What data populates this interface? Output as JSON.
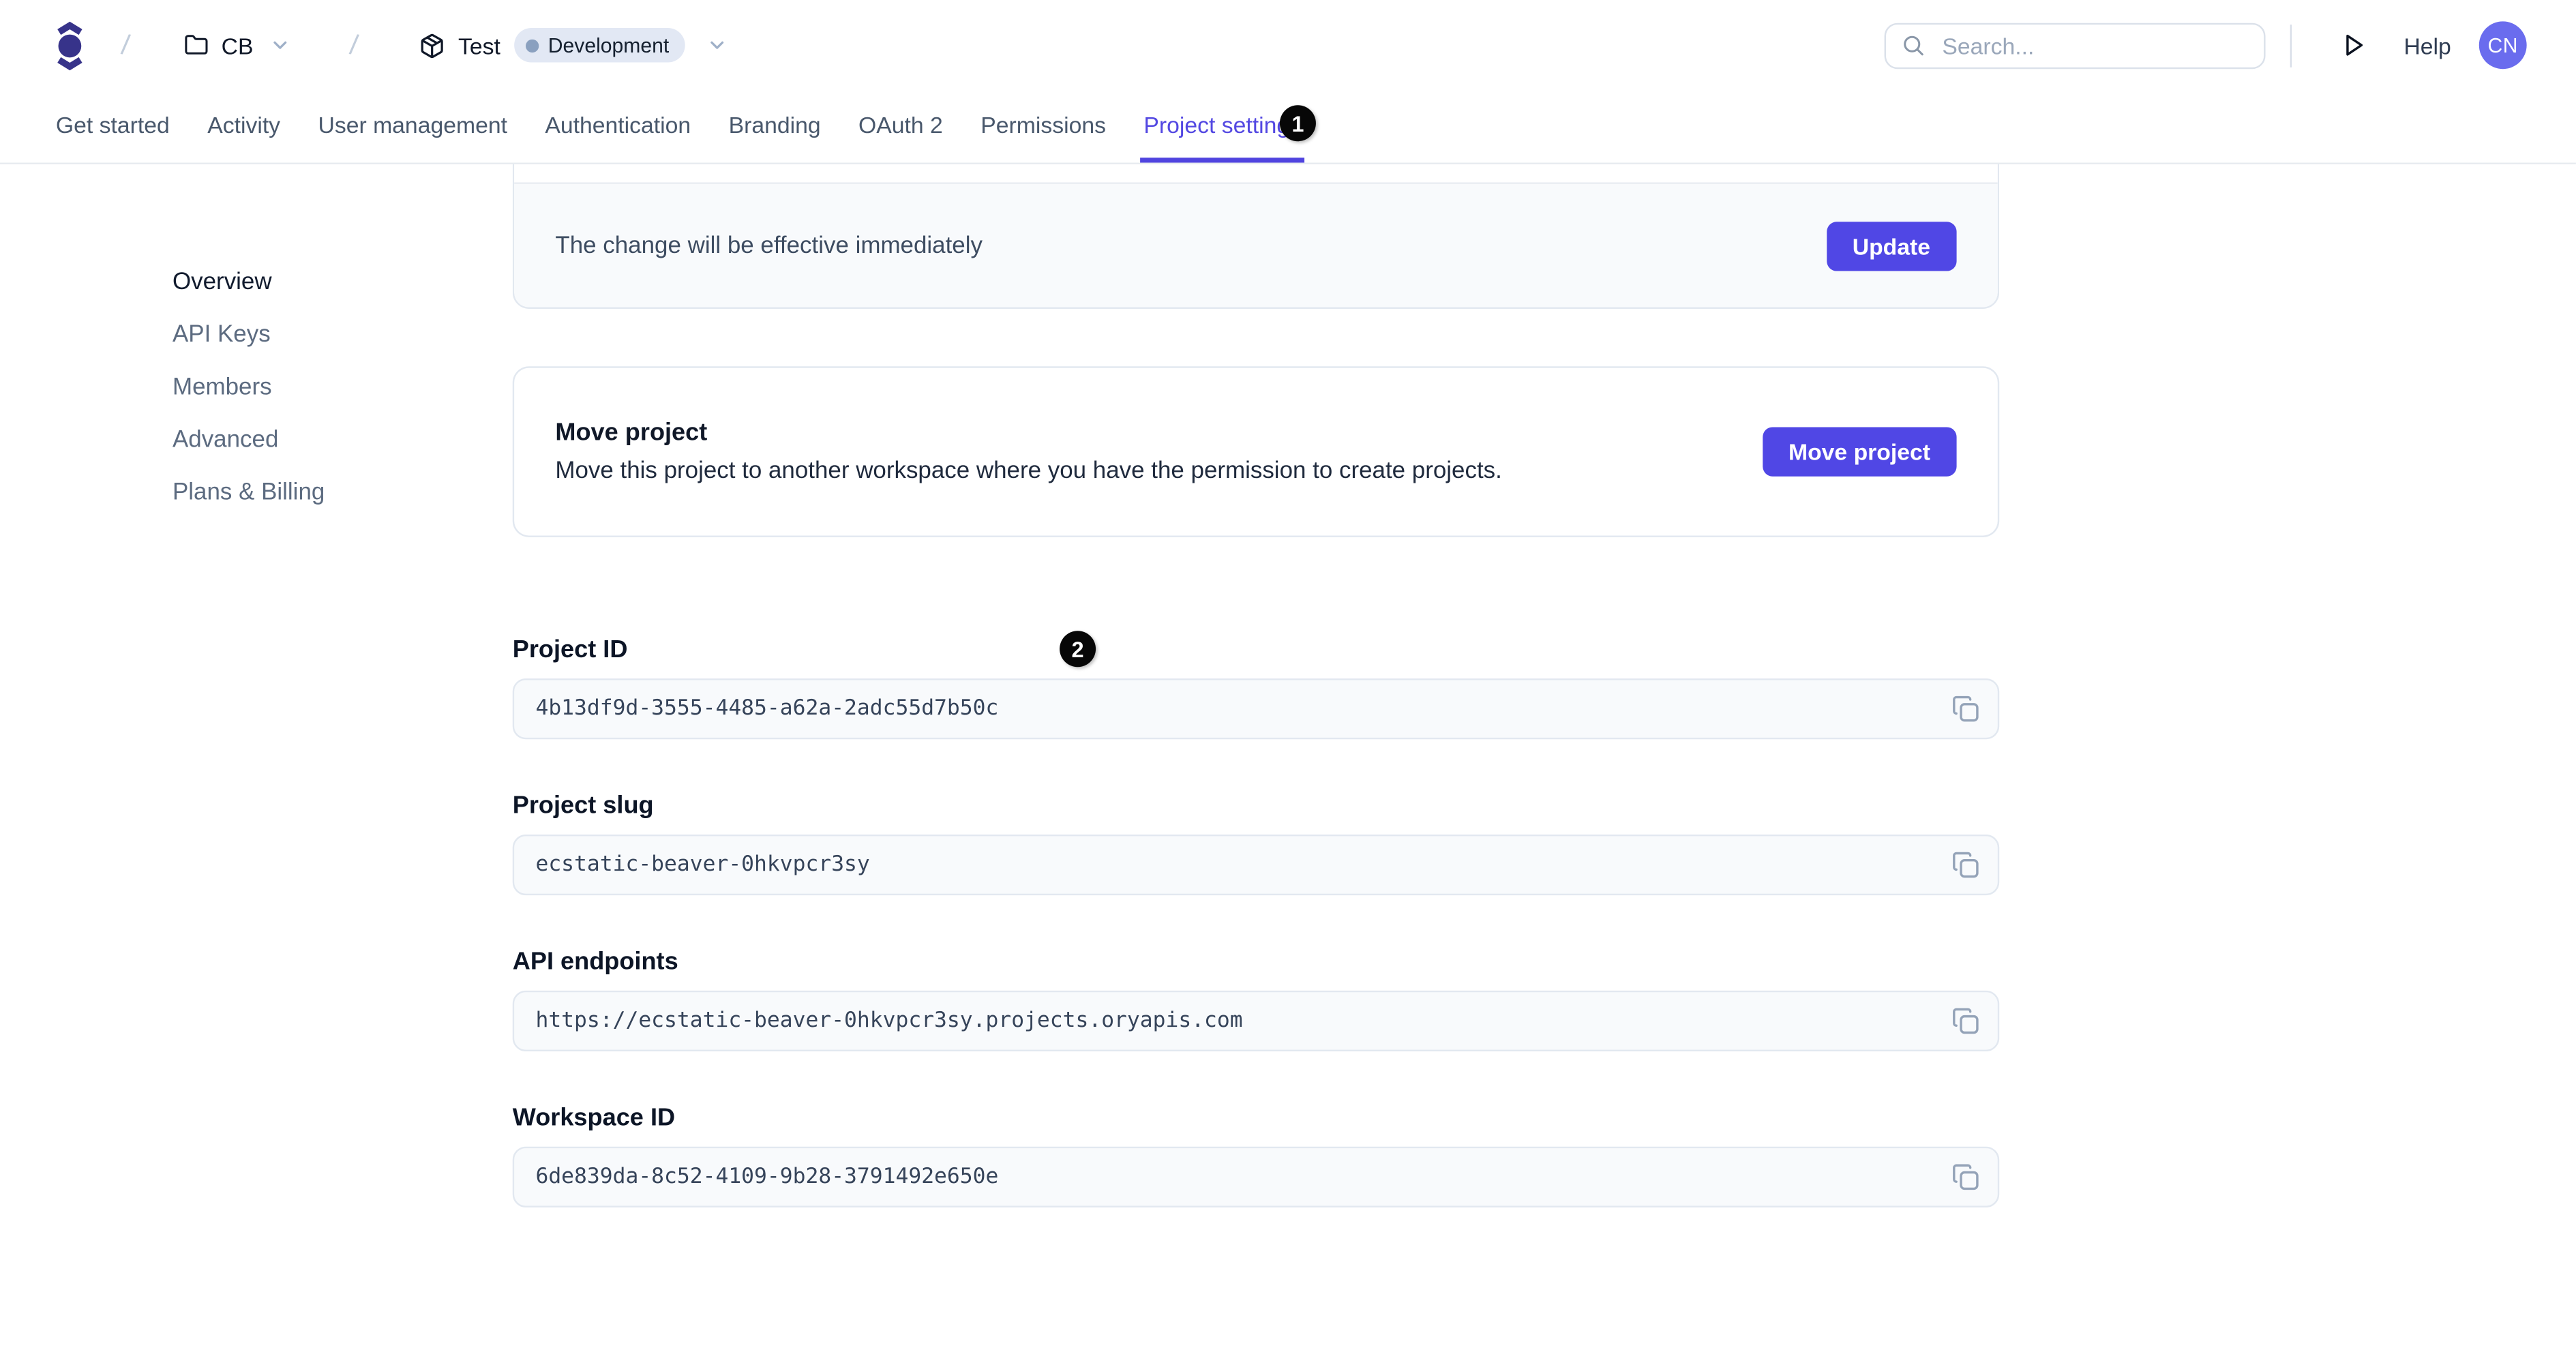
{
  "colors": {
    "accent": "#5047e5",
    "active_tab": "#5348e2",
    "logo": "#37338a",
    "avatar_bg": "#6a6cee",
    "env_badge_bg": "#e2e8f4",
    "env_dot": "#8aa0bf",
    "field_bg": "#f8fafc",
    "border": "#e2e8f0",
    "annotation_bg": "#070707"
  },
  "topbar": {
    "workspace": "CB",
    "project": "Test",
    "environment": "Development",
    "search_placeholder": "Search...",
    "help": "Help",
    "avatar": "CN"
  },
  "tabs": {
    "items": [
      "Get started",
      "Activity",
      "User management",
      "Authentication",
      "Branding",
      "OAuth 2",
      "Permissions",
      "Project settings"
    ],
    "active": "Project settings"
  },
  "annotations": {
    "mark1": "1",
    "mark2": "2"
  },
  "sidebar": {
    "items": [
      "Overview",
      "API Keys",
      "Members",
      "Advanced",
      "Plans & Billing"
    ],
    "active": "Overview"
  },
  "update_card": {
    "note": "The change will be effective immediately",
    "button": "Update"
  },
  "move_card": {
    "title": "Move project",
    "description": "Move this project to another workspace where you have the permission to create projects.",
    "button": "Move project"
  },
  "fields": [
    {
      "label": "Project ID",
      "value": "4b13df9d-3555-4485-a62a-2adc55d7b50c"
    },
    {
      "label": "Project slug",
      "value": "ecstatic-beaver-0hkvpcr3sy"
    },
    {
      "label": "API endpoints",
      "value": "https://ecstatic-beaver-0hkvpcr3sy.projects.oryapis.com"
    },
    {
      "label": "Workspace ID",
      "value": "6de839da-8c52-4109-9b28-3791492e650e"
    }
  ]
}
